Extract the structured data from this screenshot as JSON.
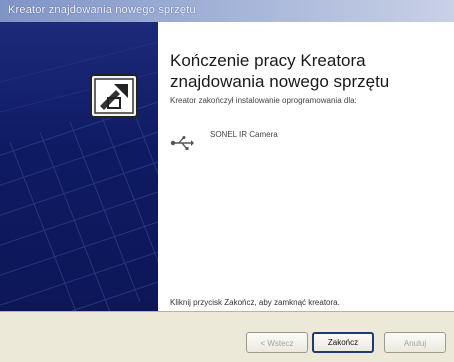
{
  "window": {
    "title": "Kreator znajdowania nowego sprzętu"
  },
  "content": {
    "heading_line1": "Kończenie pracy Kreatora",
    "heading_line2": "znajdowania nowego sprzętu",
    "subtext": "Kreator zakończył instalowanie oprogramowania dla:",
    "device_name": "SONEL IR Camera",
    "device_icon": "usb-icon",
    "footer_text": "Kliknij przycisk Zakończ, aby zamknąć kreatora."
  },
  "buttons": {
    "back": "< Wstecz",
    "finish": "Zakończ",
    "cancel": "Anuluj"
  },
  "colors": {
    "banner": "#0e1a62",
    "titlebar": "#7f94c6",
    "buttonbar": "#ece9d8"
  }
}
